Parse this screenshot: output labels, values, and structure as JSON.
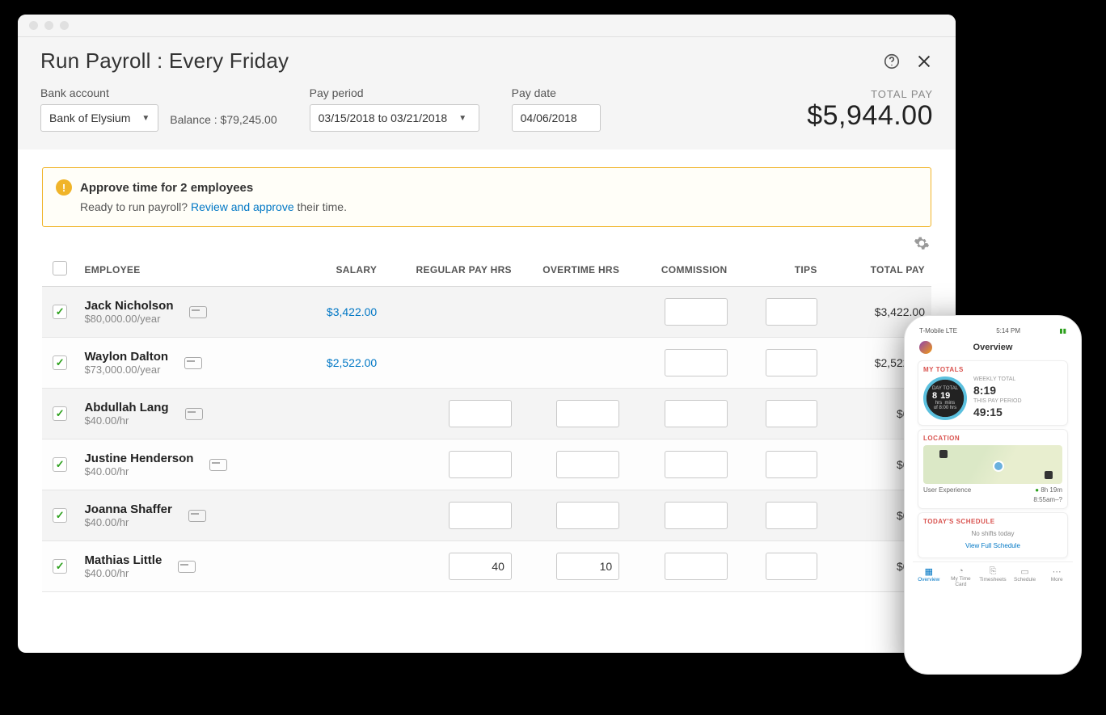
{
  "header": {
    "title": "Run Payroll : Every Friday",
    "bank_label": "Bank account",
    "bank_value": "Bank of Elysium",
    "balance_label": "Balance : $79,245.00",
    "period_label": "Pay period",
    "period_value": "03/15/2018 to 03/21/2018",
    "date_label": "Pay date",
    "date_value": "04/06/2018",
    "total_label": "TOTAL PAY",
    "total_amount": "$5,944.00"
  },
  "alert": {
    "title": "Approve time for 2 employees",
    "pre_text": "Ready to run payroll? ",
    "link_text": "Review and approve",
    "post_text": " their time."
  },
  "columns": {
    "employee": "EMPLOYEE",
    "salary": "SALARY",
    "regular": "REGULAR PAY HRS",
    "overtime": "OVERTIME HRS",
    "commission": "COMMISSION",
    "tips": "TIPS",
    "total": "TOTAL PAY"
  },
  "rows": [
    {
      "checked": true,
      "name": "Jack Nicholson",
      "rate": "$80,000.00/year",
      "salary": "$3,422.00",
      "reg": "",
      "ot": "",
      "total": "$3,422.00",
      "showHrs": false
    },
    {
      "checked": true,
      "name": "Waylon Dalton",
      "rate": "$73,000.00/year",
      "salary": "$2,522.00",
      "reg": "",
      "ot": "",
      "total": "$2,522.00",
      "showHrs": false
    },
    {
      "checked": true,
      "name": "Abdullah Lang",
      "rate": "$40.00/hr",
      "salary": "",
      "reg": "",
      "ot": "",
      "total": "$0.00",
      "showHrs": true
    },
    {
      "checked": true,
      "name": "Justine Henderson",
      "rate": "$40.00/hr",
      "salary": "",
      "reg": "",
      "ot": "",
      "total": "$0.00",
      "showHrs": true
    },
    {
      "checked": true,
      "name": "Joanna Shaffer",
      "rate": "$40.00/hr",
      "salary": "",
      "reg": "",
      "ot": "",
      "total": "$0.00",
      "showHrs": true
    },
    {
      "checked": true,
      "name": "Mathias Little",
      "rate": "$40.00/hr",
      "salary": "",
      "reg": "40",
      "ot": "10",
      "total": "$0.00",
      "showHrs": true
    }
  ],
  "phone": {
    "carrier": "T-Mobile  LTE",
    "time": "5:14 PM",
    "title": "Overview",
    "section_totals": "MY TOTALS",
    "ring_sub": "DAY TOTAL",
    "ring_h": "8",
    "ring_m": "19",
    "ring_units_h": "hrs",
    "ring_units_m": "mins",
    "ring_of": "of 8:00 hrs",
    "weekly_label": "WEEKLY TOTAL",
    "weekly_value": "8:19",
    "period_label": "THIS PAY PERIOD",
    "period_value": "49:15",
    "section_location": "LOCATION",
    "loc_name": "User Experience",
    "loc_dur": "8h 19m",
    "loc_time": "8:55am–?",
    "section_schedule": "TODAY'S SCHEDULE",
    "schedule_text": "No shifts today",
    "schedule_link": "View Full Schedule",
    "tabs": [
      "Overview",
      "My Time Card",
      "Timesheets",
      "Schedule",
      "More"
    ]
  }
}
